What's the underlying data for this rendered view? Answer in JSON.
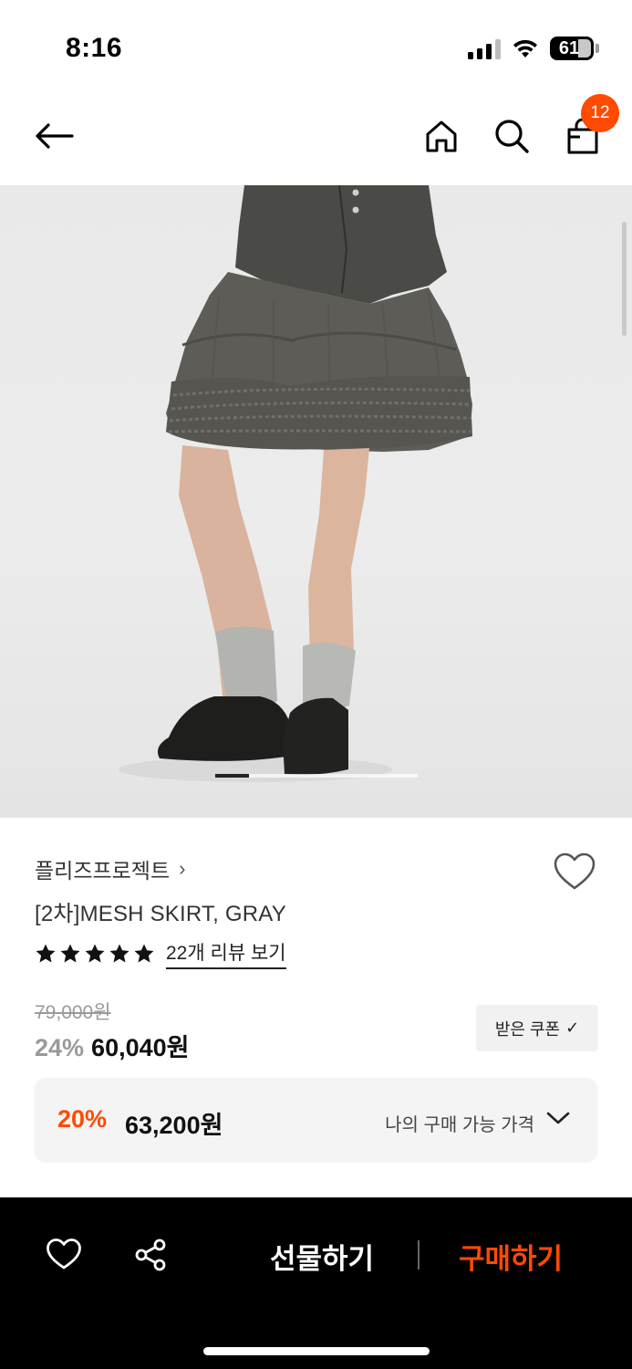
{
  "status_bar": {
    "time": "8:16",
    "battery_percent": "61",
    "icons": [
      "cellular-signal-icon",
      "wifi-icon",
      "battery-icon"
    ]
  },
  "nav": {
    "icons": [
      "back-arrow-icon",
      "home-icon",
      "search-icon",
      "shopping-bag-icon"
    ],
    "cart_count": "12"
  },
  "gallery": {
    "image_description_icon": "product-photo-skirt",
    "current_index": 1
  },
  "product": {
    "brand": "플리즈프로젝트",
    "brand_chevron": "›",
    "title": "[2차]MESH SKIRT, GRAY",
    "rating_stars": 5,
    "review_link": "22개 리뷰 보기",
    "original_price": "79,000원",
    "discount_rate": "24%",
    "sale_price": "60,040원",
    "coupon_label": "받은 쿠폰",
    "coupon_check": "✓"
  },
  "my_price": {
    "discount_rate": "20%",
    "price": "63,200원",
    "label": "나의 구매 가능 가격"
  },
  "bottom_bar": {
    "gift_label": "선물하기",
    "buy_label": "구매하기"
  },
  "colors": {
    "accent": "#ff4a00",
    "bottom_bar_bg": "#000000",
    "price_box_bg": "#f4f4f4"
  }
}
